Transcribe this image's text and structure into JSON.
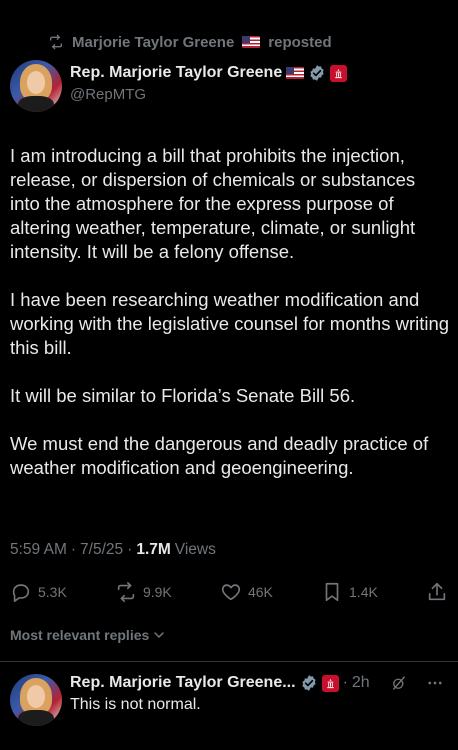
{
  "repost": {
    "name": "Marjorie Taylor Greene",
    "label": "reposted"
  },
  "post": {
    "author_name": "Rep. Marjorie Taylor Greene",
    "handle": "@RepMTG",
    "paragraphs": [
      "I am introducing a bill that prohibits the injection, release, or dispersion of chemicals or substances into the atmosphere for the express purpose of altering weather, temperature, climate, or sunlight intensity. It will be a felony offense.",
      "I have been researching weather modification and working with the legislative counsel for months writing this bill.",
      "It will be similar to Florida’s Senate Bill 56.",
      "We must end the dangerous and deadly practice of weather modification and geoengineering."
    ],
    "time": "5:59 AM",
    "date": "7/5/25",
    "views_count": "1.7M",
    "views_label": "Views"
  },
  "actions": {
    "replies": "5.3K",
    "reposts": "9.9K",
    "likes": "46K",
    "bookmarks": "1.4K"
  },
  "replies_section": {
    "label": "Most relevant replies"
  },
  "reply": {
    "author_name": "Rep. Marjorie Taylor Greene...",
    "time": "2h",
    "text": "This is not normal."
  },
  "icons": {
    "repost": "repost-icon",
    "verified": "verified-badge-icon",
    "gov": "government-badge-icon",
    "reply": "reply-icon",
    "like": "heart-icon",
    "bookmark": "bookmark-icon",
    "share": "share-icon",
    "grok": "grok-icon",
    "more": "more-icon"
  },
  "colors": {
    "background": "#000000",
    "text": "#e7e9ea",
    "muted": "#71767b",
    "verified": "#829aab",
    "gov_badge": "#c8102e"
  }
}
